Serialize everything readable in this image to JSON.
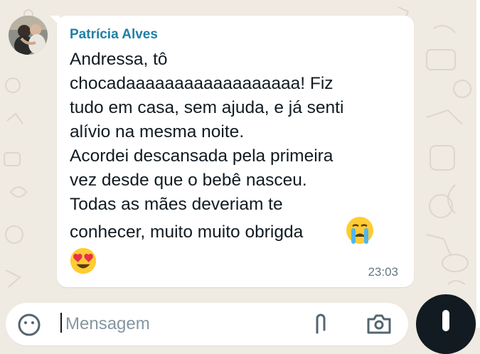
{
  "chat": {
    "sender_name": "Patrícia Alves",
    "message_lines": [
      "Andressa, tô",
      "chocadaaaaaaaaaaaaaaaaaa! Fiz",
      "tudo em casa, sem ajuda, e já senti",
      "alívio na mesma noite.",
      "Acordei descansada pela primeira",
      "vez desde que o bebê nasceu.",
      "Todas as mães deveriam te",
      "conhecer, muito muito obrigda"
    ],
    "emojis": [
      "crying-face",
      "heart-eyes-face"
    ],
    "timestamp": "23:03"
  },
  "composer": {
    "placeholder": "Mensagem",
    "icons": [
      "emoji-icon",
      "attach-icon",
      "camera-icon",
      "mic-icon"
    ]
  },
  "colors": {
    "wallpaper": "#efeae2",
    "bubble": "#ffffff",
    "sender": "#1f7fa6",
    "text": "#111b21",
    "timestamp": "#667781",
    "action_button": "#111b21"
  }
}
